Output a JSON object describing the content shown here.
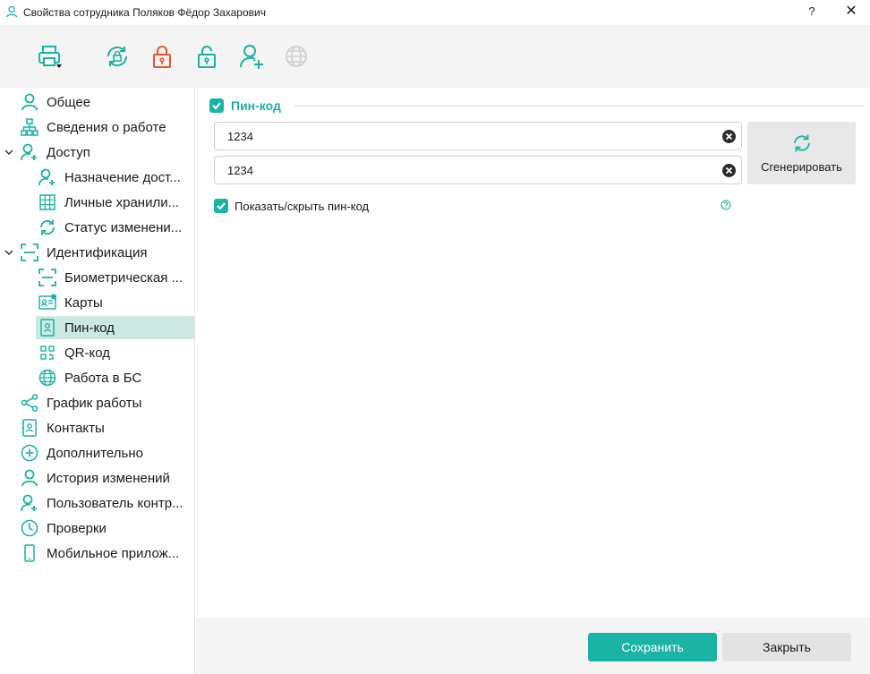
{
  "window": {
    "title": "Свойства сотрудника Поляков Фёдор Захарович",
    "help": "?",
    "close": "✕"
  },
  "toolbar": {
    "buttons": [
      {
        "name": "print-icon",
        "color": "#1bb3a2"
      },
      {
        "name": "sync-lock-icon",
        "color": "#1bb3a2"
      },
      {
        "name": "lock-closed-icon",
        "color": "#e4572e"
      },
      {
        "name": "lock-open-icon",
        "color": "#1bb3a2"
      },
      {
        "name": "user-add-icon",
        "color": "#1bb3a2"
      },
      {
        "name": "globe-icon",
        "color": "#cfcfcf"
      }
    ]
  },
  "sidebar": {
    "items": [
      {
        "label": "Общее",
        "icon": "user-icon"
      },
      {
        "label": "Сведения о работе",
        "icon": "org-chart-icon"
      },
      {
        "label": "Доступ",
        "icon": "user-key-icon"
      },
      {
        "label": "Назначение дост...",
        "icon": "user-add-icon"
      },
      {
        "label": "Личные хранили...",
        "icon": "grid-icon"
      },
      {
        "label": "Статус изменени...",
        "icon": "refresh-icon"
      },
      {
        "label": "Идентификация",
        "icon": "scan-icon"
      },
      {
        "label": "Биометрическая ...",
        "icon": "scan-icon"
      },
      {
        "label": "Карты",
        "icon": "id-card-icon"
      },
      {
        "label": "Пин-код",
        "icon": "pin-icon"
      },
      {
        "label": "QR-код",
        "icon": "qr-icon"
      },
      {
        "label": "Работа в БС",
        "icon": "globe-icon"
      },
      {
        "label": "График работы",
        "icon": "share-icon"
      },
      {
        "label": "Контакты",
        "icon": "contacts-icon"
      },
      {
        "label": "Дополнительно",
        "icon": "plus-circle-icon"
      },
      {
        "label": "История изменений",
        "icon": "user-icon"
      },
      {
        "label": "Пользователь контр...",
        "icon": "user-add-icon"
      },
      {
        "label": "Проверки",
        "icon": "clock-icon"
      },
      {
        "label": "Мобильное прилож...",
        "icon": "phone-icon"
      }
    ],
    "selected": "Пин-код"
  },
  "main": {
    "section_title": "Пин-код",
    "pin_value": "1234",
    "pin_confirm_value": "1234",
    "generate_label": "Сгенерировать",
    "show_hide_label": "Показать/скрыть пин-код"
  },
  "footer": {
    "save_label": "Сохранить",
    "close_label": "Закрыть"
  },
  "colors": {
    "accent": "#1bb3a2",
    "selected_bg": "#cce8e3",
    "lock_red": "#e4572e"
  }
}
